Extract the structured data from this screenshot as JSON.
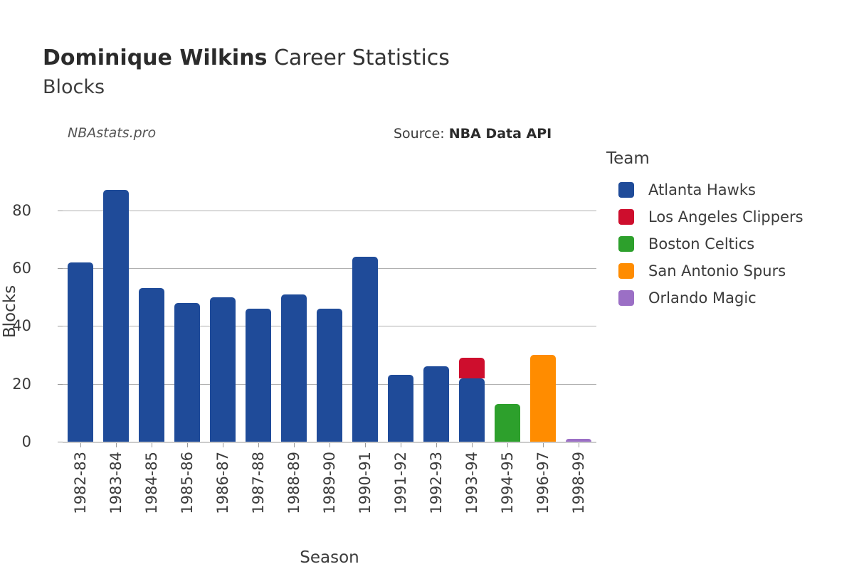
{
  "header": {
    "title_bold": "Dominique Wilkins",
    "title_rest": " Career Statistics",
    "subtitle": "Blocks",
    "watermark": "NBAstats.pro",
    "source_prefix": "Source:",
    "source_name": "NBA Data API"
  },
  "legend": {
    "title": "Team",
    "items": [
      {
        "label": "Atlanta Hawks",
        "color": "#1F4B99"
      },
      {
        "label": "Los Angeles Clippers",
        "color": "#CE0E2D"
      },
      {
        "label": "Boston Celtics",
        "color": "#2DA02C"
      },
      {
        "label": "San Antonio Spurs",
        "color": "#FF8C00"
      },
      {
        "label": "Orlando Magic",
        "color": "#9B6FC5"
      }
    ]
  },
  "chart_data": {
    "type": "bar",
    "title": "Dominique Wilkins Career Statistics",
    "subtitle": "Blocks",
    "xlabel": "Season",
    "ylabel": "Blocks",
    "ylim": [
      0,
      90
    ],
    "yticks": [
      0,
      20,
      40,
      60,
      80
    ],
    "ytick_labels": [
      "0",
      "20",
      "40",
      "60",
      "80"
    ],
    "grid": true,
    "stacked": true,
    "legend_position": "right",
    "legend_title": "Team",
    "categories": [
      "1982-83",
      "1983-84",
      "1984-85",
      "1985-86",
      "1986-87",
      "1987-88",
      "1988-89",
      "1989-90",
      "1990-91",
      "1991-92",
      "1992-93",
      "1993-94",
      "1994-95",
      "1996-97",
      "1998-99"
    ],
    "series": [
      {
        "name": "Atlanta Hawks",
        "color": "#1F4B99",
        "values": [
          62,
          87,
          53,
          48,
          50,
          46,
          51,
          46,
          64,
          23,
          26,
          22,
          0,
          0,
          0
        ]
      },
      {
        "name": "Los Angeles Clippers",
        "color": "#CE0E2D",
        "values": [
          0,
          0,
          0,
          0,
          0,
          0,
          0,
          0,
          0,
          0,
          0,
          7,
          0,
          0,
          0
        ]
      },
      {
        "name": "Boston Celtics",
        "color": "#2DA02C",
        "values": [
          0,
          0,
          0,
          0,
          0,
          0,
          0,
          0,
          0,
          0,
          0,
          0,
          13,
          0,
          0
        ]
      },
      {
        "name": "San Antonio Spurs",
        "color": "#FF8C00",
        "values": [
          0,
          0,
          0,
          0,
          0,
          0,
          0,
          0,
          0,
          0,
          0,
          0,
          0,
          30,
          0
        ]
      },
      {
        "name": "Orlando Magic",
        "color": "#9B6FC5",
        "values": [
          0,
          0,
          0,
          0,
          0,
          0,
          0,
          0,
          0,
          0,
          0,
          0,
          0,
          0,
          1
        ]
      }
    ]
  }
}
